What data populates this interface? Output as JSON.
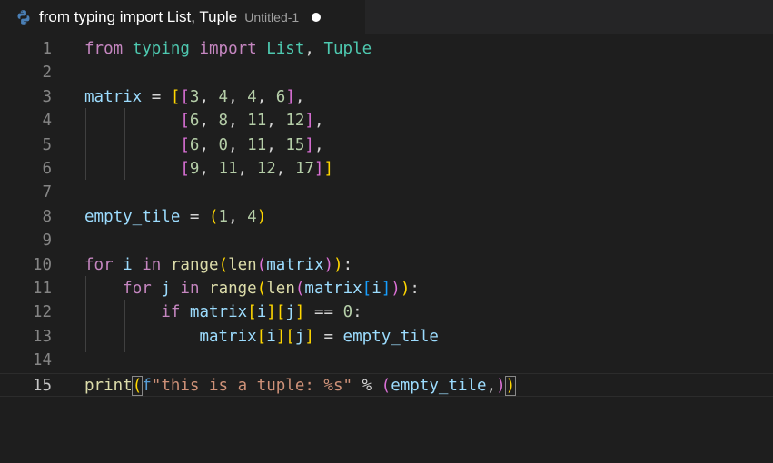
{
  "tab": {
    "title": "from typing import List, Tuple",
    "description": "Untitled-1",
    "icon": "python-icon"
  },
  "editor": {
    "active_line": 15,
    "lines": [
      {
        "number": 1,
        "tokens": [
          [
            "from",
            "kw"
          ],
          [
            " ",
            "op"
          ],
          [
            "typing",
            "mod"
          ],
          [
            " ",
            "op"
          ],
          [
            "import",
            "kw"
          ],
          [
            " ",
            "op"
          ],
          [
            "List",
            "mod"
          ],
          [
            ", ",
            "op"
          ],
          [
            "Tuple",
            "mod"
          ]
        ]
      },
      {
        "number": 2,
        "tokens": []
      },
      {
        "number": 3,
        "tokens": [
          [
            "matrix",
            "var"
          ],
          [
            " = ",
            "op"
          ],
          [
            "[",
            "b1"
          ],
          [
            "[",
            "b2"
          ],
          [
            "3",
            "num"
          ],
          [
            ", ",
            "op"
          ],
          [
            "4",
            "num"
          ],
          [
            ", ",
            "op"
          ],
          [
            "4",
            "num"
          ],
          [
            ", ",
            "op"
          ],
          [
            "6",
            "num"
          ],
          [
            "]",
            "b2"
          ],
          [
            ",",
            "op"
          ]
        ]
      },
      {
        "number": 4,
        "tokens": [
          [
            "          ",
            "op"
          ],
          [
            "[",
            "b2"
          ],
          [
            "6",
            "num"
          ],
          [
            ", ",
            "op"
          ],
          [
            "8",
            "num"
          ],
          [
            ", ",
            "op"
          ],
          [
            "11",
            "num"
          ],
          [
            ", ",
            "op"
          ],
          [
            "12",
            "num"
          ],
          [
            "]",
            "b2"
          ],
          [
            ",",
            "op"
          ]
        ]
      },
      {
        "number": 5,
        "tokens": [
          [
            "          ",
            "op"
          ],
          [
            "[",
            "b2"
          ],
          [
            "6",
            "num"
          ],
          [
            ", ",
            "op"
          ],
          [
            "0",
            "num"
          ],
          [
            ", ",
            "op"
          ],
          [
            "11",
            "num"
          ],
          [
            ", ",
            "op"
          ],
          [
            "15",
            "num"
          ],
          [
            "]",
            "b2"
          ],
          [
            ",",
            "op"
          ]
        ]
      },
      {
        "number": 6,
        "tokens": [
          [
            "          ",
            "op"
          ],
          [
            "[",
            "b2"
          ],
          [
            "9",
            "num"
          ],
          [
            ", ",
            "op"
          ],
          [
            "11",
            "num"
          ],
          [
            ", ",
            "op"
          ],
          [
            "12",
            "num"
          ],
          [
            ", ",
            "op"
          ],
          [
            "17",
            "num"
          ],
          [
            "]",
            "b2"
          ],
          [
            "]",
            "b1"
          ]
        ]
      },
      {
        "number": 7,
        "tokens": []
      },
      {
        "number": 8,
        "tokens": [
          [
            "empty_tile",
            "var"
          ],
          [
            " = ",
            "op"
          ],
          [
            "(",
            "b1"
          ],
          [
            "1",
            "num"
          ],
          [
            ", ",
            "op"
          ],
          [
            "4",
            "num"
          ],
          [
            ")",
            "b1"
          ]
        ]
      },
      {
        "number": 9,
        "tokens": []
      },
      {
        "number": 10,
        "tokens": [
          [
            "for",
            "kw"
          ],
          [
            " ",
            "op"
          ],
          [
            "i",
            "var"
          ],
          [
            " ",
            "op"
          ],
          [
            "in",
            "kw"
          ],
          [
            " ",
            "op"
          ],
          [
            "range",
            "fn"
          ],
          [
            "(",
            "b1"
          ],
          [
            "len",
            "fn"
          ],
          [
            "(",
            "b2"
          ],
          [
            "matrix",
            "var"
          ],
          [
            ")",
            "b2"
          ],
          [
            ")",
            "b1"
          ],
          [
            ":",
            "op"
          ]
        ]
      },
      {
        "number": 11,
        "tokens": [
          [
            "    ",
            "op"
          ],
          [
            "for",
            "kw"
          ],
          [
            " ",
            "op"
          ],
          [
            "j",
            "var"
          ],
          [
            " ",
            "op"
          ],
          [
            "in",
            "kw"
          ],
          [
            " ",
            "op"
          ],
          [
            "range",
            "fn"
          ],
          [
            "(",
            "b1"
          ],
          [
            "len",
            "fn"
          ],
          [
            "(",
            "b2"
          ],
          [
            "matrix",
            "var"
          ],
          [
            "[",
            "b3"
          ],
          [
            "i",
            "var"
          ],
          [
            "]",
            "b3"
          ],
          [
            ")",
            "b2"
          ],
          [
            ")",
            "b1"
          ],
          [
            ":",
            "op"
          ]
        ]
      },
      {
        "number": 12,
        "tokens": [
          [
            "        ",
            "op"
          ],
          [
            "if",
            "kw"
          ],
          [
            " ",
            "op"
          ],
          [
            "matrix",
            "var"
          ],
          [
            "[",
            "b1"
          ],
          [
            "i",
            "var"
          ],
          [
            "]",
            "b1"
          ],
          [
            "[",
            "b1"
          ],
          [
            "j",
            "var"
          ],
          [
            "]",
            "b1"
          ],
          [
            " == ",
            "op"
          ],
          [
            "0",
            "num"
          ],
          [
            ":",
            "op"
          ]
        ]
      },
      {
        "number": 13,
        "tokens": [
          [
            "            ",
            "op"
          ],
          [
            "matrix",
            "var"
          ],
          [
            "[",
            "b1"
          ],
          [
            "i",
            "var"
          ],
          [
            "]",
            "b1"
          ],
          [
            "[",
            "b1"
          ],
          [
            "j",
            "var"
          ],
          [
            "]",
            "b1"
          ],
          [
            " = ",
            "op"
          ],
          [
            "empty_tile",
            "var"
          ]
        ]
      },
      {
        "number": 14,
        "tokens": []
      },
      {
        "number": 15,
        "tokens": [
          [
            "print",
            "fn"
          ],
          [
            "(",
            "b1m"
          ],
          [
            "f",
            "fpre"
          ],
          [
            "\"this is a tuple: %s\"",
            "str"
          ],
          [
            " % ",
            "op"
          ],
          [
            "(",
            "b2"
          ],
          [
            "empty_tile",
            "var"
          ],
          [
            ",",
            "op"
          ],
          [
            ")",
            "b2"
          ],
          [
            ")",
            "b1m"
          ]
        ]
      }
    ]
  }
}
